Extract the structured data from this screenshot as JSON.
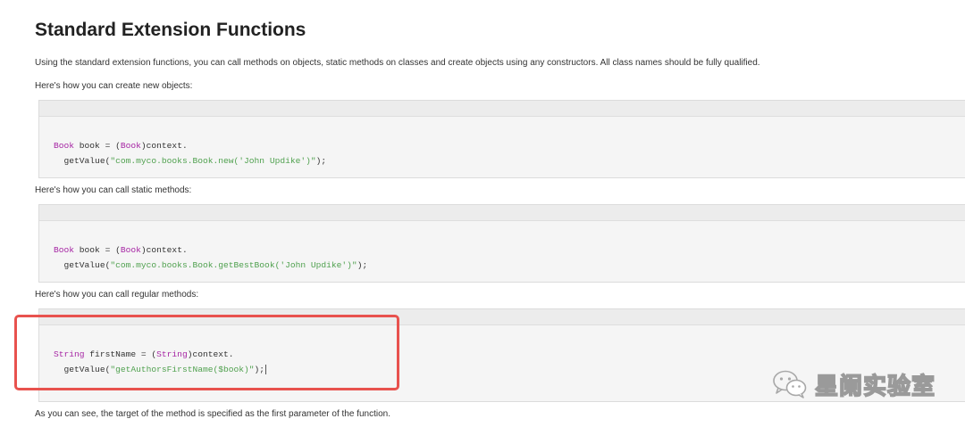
{
  "title": "Standard Extension Functions",
  "intro": "Using the standard extension functions, you can call methods on objects, static methods on classes and create objects using any constructors. All class names should be fully qualified.",
  "sections": [
    {
      "caption": "Here's how you can create new objects:",
      "code": {
        "line1_type": "Book",
        "line1_var": " book = (",
        "line1_cast": "Book",
        "line1_rest": ")context.",
        "line2_call": "  getValue(",
        "line2_str": "\"com.myco.books.Book.new('John Updike')\"",
        "line2_end": ");"
      }
    },
    {
      "caption": "Here's how you can call static methods:",
      "code": {
        "line1_type": "Book",
        "line1_var": " book = (",
        "line1_cast": "Book",
        "line1_rest": ")context.",
        "line2_call": "  getValue(",
        "line2_str": "\"com.myco.books.Book.getBestBook('John Updike')\"",
        "line2_end": ");"
      }
    },
    {
      "caption": "Here's how you can call regular methods:",
      "code": {
        "line1_type": "String",
        "line1_var": " firstName = (",
        "line1_cast": "String",
        "line1_rest": ")context.",
        "line2_call": "  getValue(",
        "line2_str": "\"getAuthorsFirstName($book)\"",
        "line2_end": ");"
      }
    }
  ],
  "outro": "As you can see, the target of the method is specified as the first parameter of the function.",
  "watermark": {
    "text": "星阑实验室",
    "icon": "wechat-icon"
  },
  "colors": {
    "highlight_border": "#e8524e",
    "keyword": "#a626a4",
    "string": "#50a14f"
  }
}
